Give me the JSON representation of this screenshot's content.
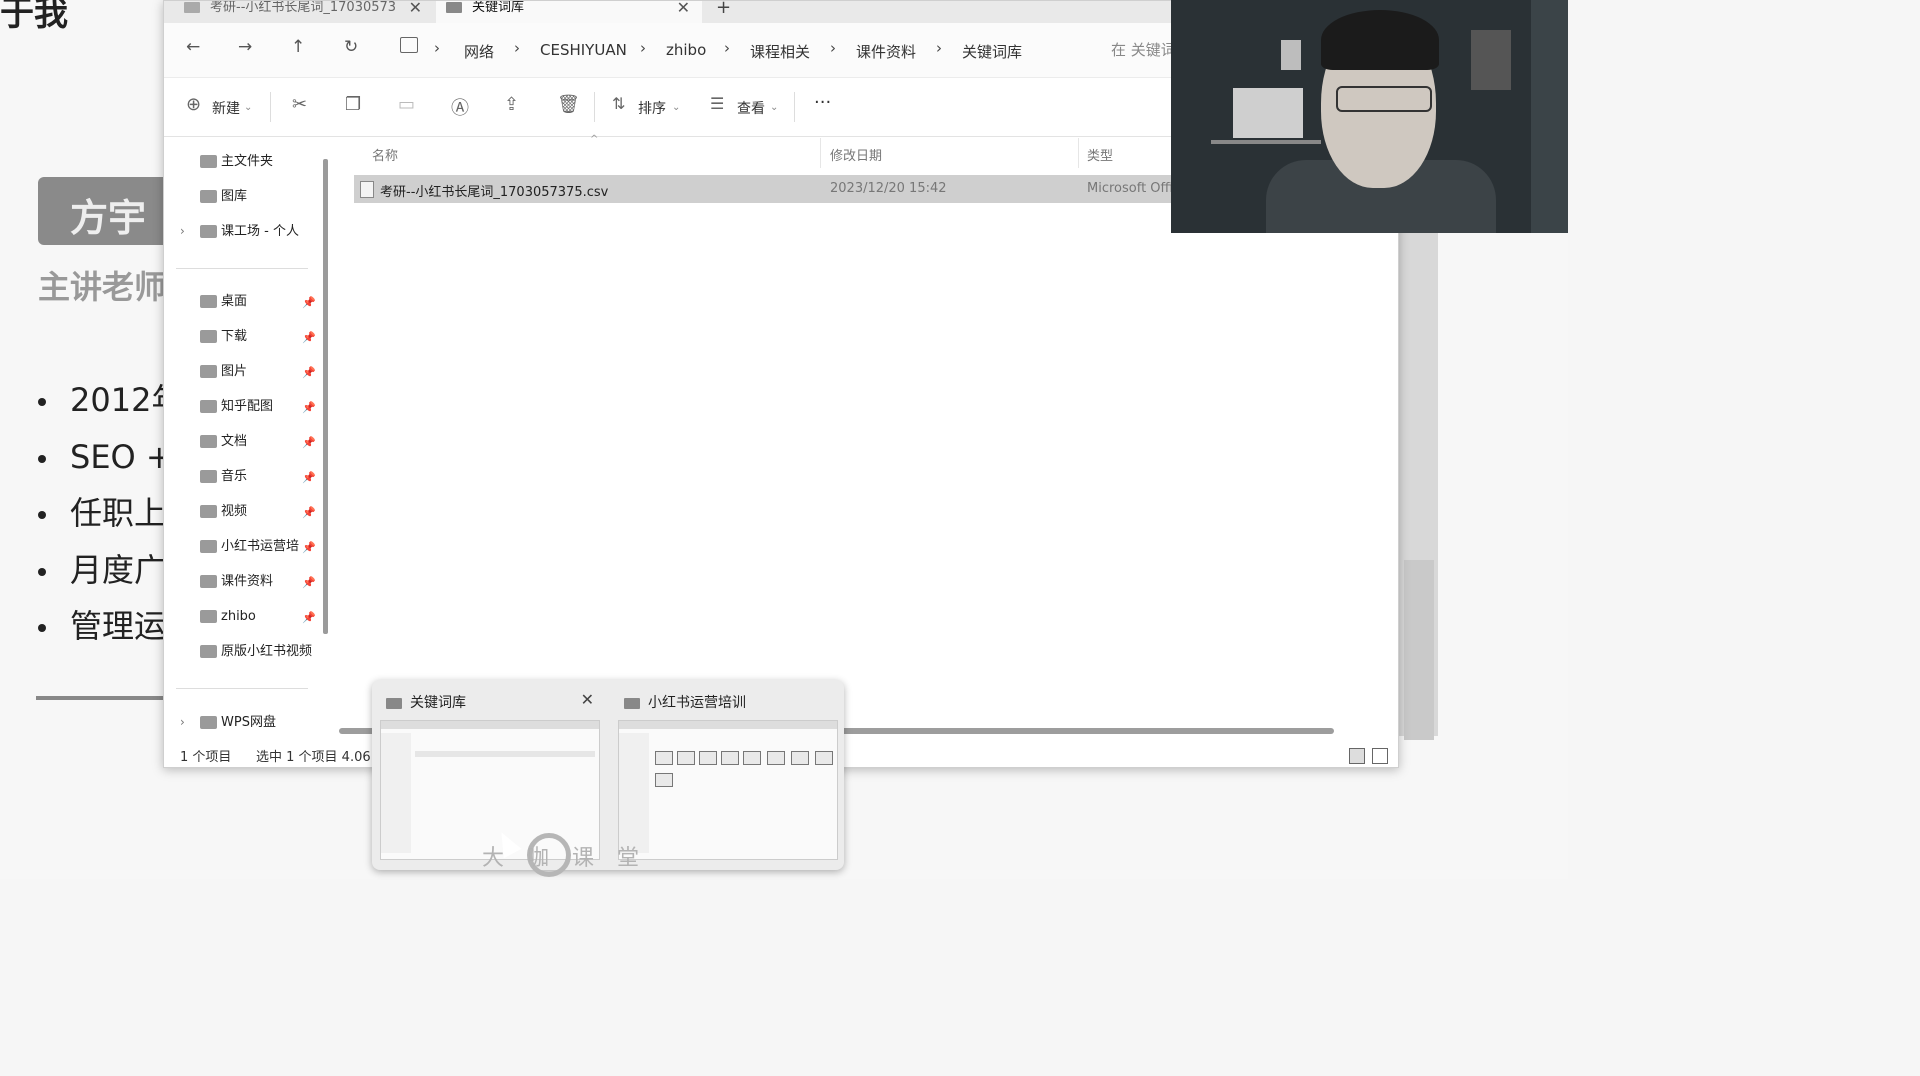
{
  "slide": {
    "title": "于我",
    "name": "方宇",
    "subtitle": "主讲老师",
    "bullets": [
      "2012年",
      "SEO +",
      "任职上",
      "月度广",
      "管理运"
    ]
  },
  "tabs": [
    {
      "label": "考研--小红书长尾词_17030573"
    },
    {
      "label": "关键词库"
    }
  ],
  "nav": {
    "back": "←",
    "forward": "→",
    "up": "↑",
    "refresh": "↻",
    "breadcrumbs": [
      "网络",
      "CESHIYUAN",
      "zhibo",
      "课程相关",
      "课件资料",
      "关键词库"
    ],
    "search_placeholder": "在 关键词"
  },
  "toolbar": {
    "new_label": "新建",
    "sort_label": "排序",
    "view_label": "查看",
    "more": "···"
  },
  "sidebar": {
    "top": [
      {
        "label": "主文件夹",
        "icon": "home-icon"
      },
      {
        "label": "图库",
        "icon": "gallery-icon"
      },
      {
        "label": "课工场 - 个人",
        "icon": "cloud-icon"
      }
    ],
    "pinned": [
      {
        "label": "桌面",
        "icon": "desktop-icon"
      },
      {
        "label": "下载",
        "icon": "download-icon"
      },
      {
        "label": "图片",
        "icon": "pictures-icon"
      },
      {
        "label": "知乎配图",
        "icon": "folder-icon"
      },
      {
        "label": "文档",
        "icon": "documents-icon"
      },
      {
        "label": "音乐",
        "icon": "music-icon"
      },
      {
        "label": "视频",
        "icon": "video-icon"
      },
      {
        "label": "小红书运营培",
        "icon": "folder-icon"
      },
      {
        "label": "课件资料",
        "icon": "folder-icon"
      },
      {
        "label": "zhibo",
        "icon": "folder-icon"
      },
      {
        "label": "原版小红书视频",
        "icon": "folder-icon"
      }
    ],
    "bottom": [
      {
        "label": "WPS网盘",
        "icon": "cloud-icon"
      }
    ]
  },
  "columns": {
    "name": "名称",
    "modified": "修改日期",
    "type": "类型"
  },
  "files": [
    {
      "name": "考研--小红书长尾词_1703057375.csv",
      "modified": "2023/12/20 15:42",
      "type": "Microsoft Offi"
    }
  ],
  "status": {
    "count": "1 个项目",
    "selected": "选中 1 个项目 4.06"
  },
  "preview": {
    "windows": [
      {
        "title": "关键词库"
      },
      {
        "title": "小红书运营培训"
      }
    ],
    "watermark": "大 咖 课 堂"
  },
  "colors": {
    "selection": "#cfcfcf",
    "window": "#ffffff",
    "tabbar": "#e9e9e9"
  }
}
